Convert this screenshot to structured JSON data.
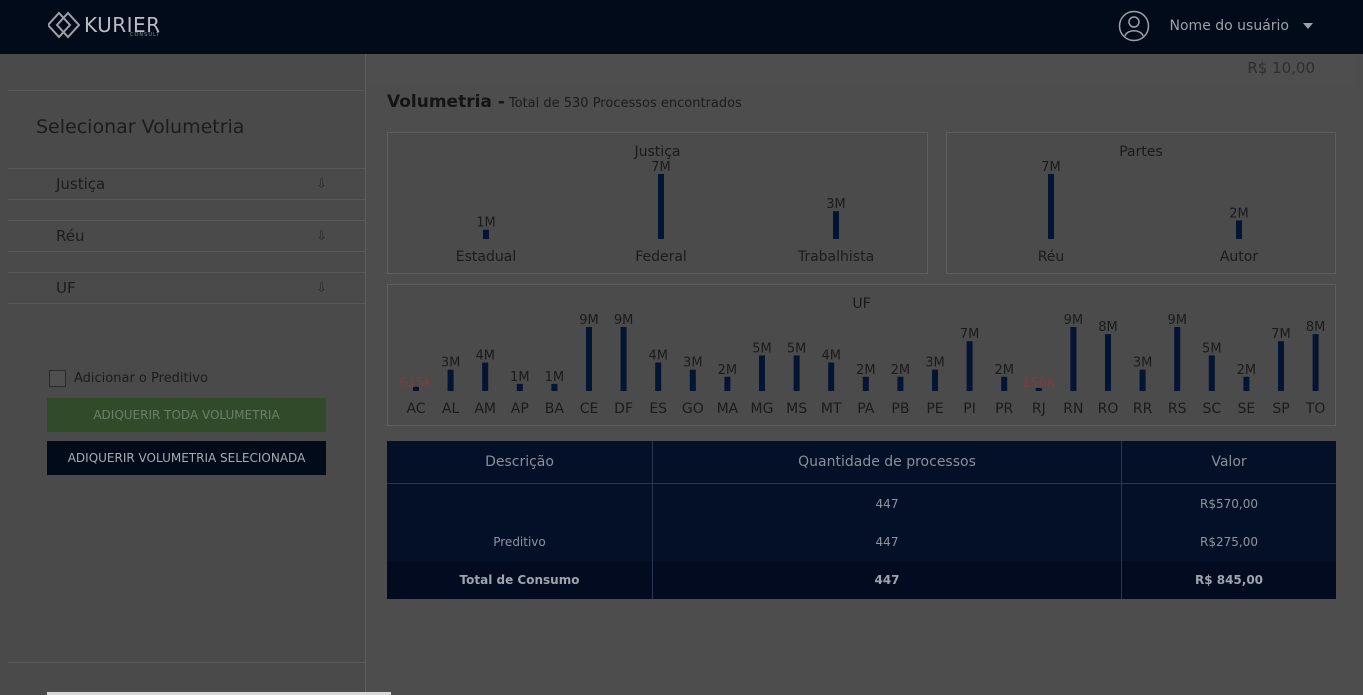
{
  "header": {
    "logo_text": "KURIER",
    "logo_sub": "CONSULT",
    "user_name": "Nome do usuário"
  },
  "sidebar": {
    "title": "Selecionar Volumetria",
    "filters": [
      {
        "label": "Justiça",
        "icon": "download-arrow-icon"
      },
      {
        "label": "Réu",
        "icon": "download-arrow-icon"
      },
      {
        "label": "UF",
        "icon": "download-arrow-icon"
      }
    ],
    "checkbox_label": "Adicionar o Preditivo",
    "btn_all": "ADIQUERIR TODA VOLUMETRIA",
    "btn_selected": "ADIQUERIR VOLUMETRIA SELECIONADA"
  },
  "main": {
    "balance": "R$ 10,00",
    "title": "Volumetria -",
    "subtitle": "Total de 530 Processos encontrados"
  },
  "chart_data": [
    {
      "type": "bar",
      "title": "Justiça",
      "categories": [
        "Estadual",
        "Federal",
        "Trabalhista"
      ],
      "values": [
        1000000,
        7000000,
        3000000
      ],
      "labels": [
        "1M",
        "7M",
        "3M"
      ]
    },
    {
      "type": "bar",
      "title": "Partes",
      "categories": [
        "Réu",
        "Autor"
      ],
      "values": [
        7000000,
        2000000
      ],
      "labels": [
        "7M",
        "2M"
      ]
    },
    {
      "type": "bar",
      "title": "UF",
      "categories": [
        "AC",
        "AL",
        "AM",
        "AP",
        "BA",
        "CE",
        "DF",
        "ES",
        "GO",
        "MA",
        "MG",
        "MS",
        "MT",
        "PA",
        "PB",
        "PE",
        "PI",
        "PR",
        "RJ",
        "RN",
        "RO",
        "RR",
        "RS",
        "SC",
        "SE",
        "SP",
        "TO"
      ],
      "values": [
        615000,
        3000000,
        4000000,
        1000000,
        1000000,
        9000000,
        9000000,
        4000000,
        3000000,
        2000000,
        5000000,
        5000000,
        4000000,
        2000000,
        2000000,
        3000000,
        7000000,
        2000000,
        150000,
        9000000,
        8000000,
        3000000,
        9000000,
        5000000,
        2000000,
        7000000,
        8000000
      ],
      "labels": [
        "615K",
        "3M",
        "4M",
        "1M",
        "1M",
        "9M",
        "9M",
        "4M",
        "3M",
        "2M",
        "5M",
        "5M",
        "4M",
        "2M",
        "2M",
        "3M",
        "7M",
        "2M",
        "150K",
        "9M",
        "8M",
        "3M",
        "9M",
        "5M",
        "2M",
        "7M",
        "8M"
      ],
      "highlight_labels": [
        "615K",
        "150K"
      ],
      "highlight_color": "#7a3e3e"
    }
  ],
  "table": {
    "headers": [
      "Descrição",
      "Quantidade de processos",
      "Valor"
    ],
    "rows": [
      [
        "",
        "447",
        "R$570,00"
      ],
      [
        "Preditivo",
        "447",
        "R$275,00"
      ]
    ],
    "total": [
      "Total de Consumo",
      "447",
      "R$ 845,00"
    ]
  },
  "colors": {
    "bar": "#041433",
    "header_bg": "#020b1a",
    "table_bg": "#031028",
    "btn_green": "#314a2a"
  }
}
